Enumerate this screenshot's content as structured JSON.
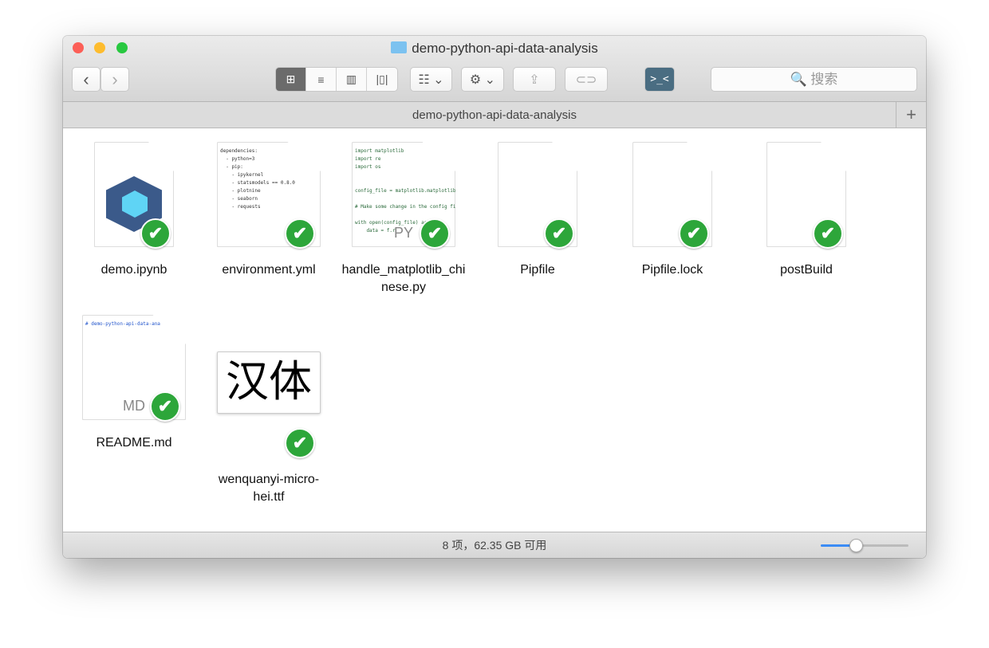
{
  "window": {
    "title": "demo-python-api-data-analysis",
    "path_title": "demo-python-api-data-analysis"
  },
  "toolbar": {
    "back": "‹",
    "forward": "›",
    "view_icon": "⊞",
    "list_icon": "≡",
    "columns_icon": "▥",
    "coverflow_icon": "|▯|",
    "arrange": "☷ ⌄",
    "action": "⚙ ⌄",
    "share": "⇪",
    "tag": "⊂⊃",
    "terminal": ">_<",
    "search_placeholder": "🔍 搜索",
    "add_tab": "+"
  },
  "files": [
    {
      "name": "demo.ipynb",
      "preview": "",
      "ext": ""
    },
    {
      "name": "environment.yml",
      "preview": "dependencies:\n  - python=3\n  - pip:\n    - ipykernel\n    - statsmodels == 0.8.0\n    - plotnine\n    - seaborn\n    - requests",
      "ext": ""
    },
    {
      "name": "handle_matplotlib_chinese.py",
      "preview": "import matplotlib\nimport re\nimport os\n\n\nconfig_file = matplotlib.matplotlib\n\n# Make some change in the config fi\n\nwith open(config_file) as f\n    data = f.r",
      "ext": "PY"
    },
    {
      "name": "Pipfile",
      "preview": "",
      "ext": ""
    },
    {
      "name": "Pipfile.lock",
      "preview": "",
      "ext": ""
    },
    {
      "name": "postBuild",
      "preview": "",
      "ext": ""
    },
    {
      "name": "README.md",
      "preview": "# demo-python-api-data-ana",
      "ext": "MD"
    },
    {
      "name": "wenquanyi-micro-hei.ttf",
      "preview": "汉体",
      "ext": ""
    }
  ],
  "status": {
    "text": "8 项，62.35 GB 可用",
    "zoom_fraction": 0.4
  },
  "sync_check": "✔"
}
